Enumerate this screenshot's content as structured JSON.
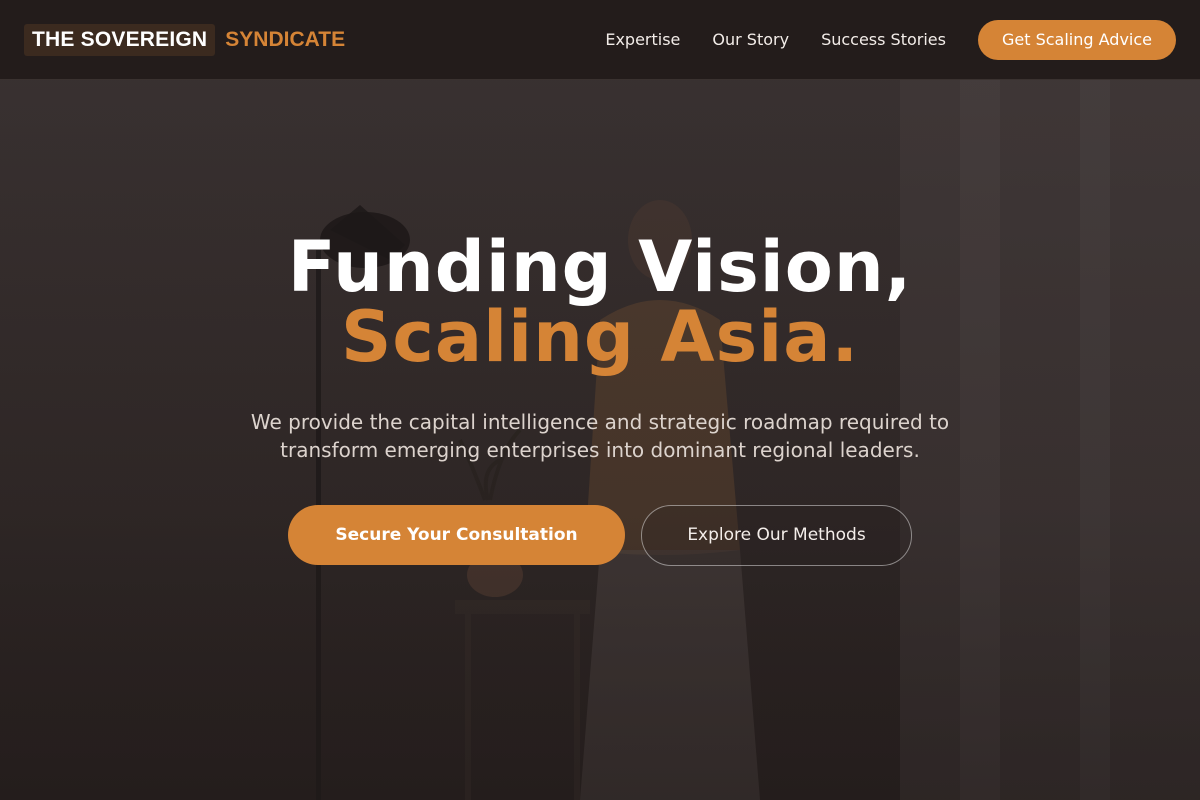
{
  "brand": {
    "name_part1": "THE SOVEREIGN",
    "name_part2": "SYNDICATE"
  },
  "nav": {
    "links": [
      {
        "label": "Expertise"
      },
      {
        "label": "Our Story"
      },
      {
        "label": "Success Stories"
      }
    ],
    "cta_label": "Get Scaling Advice"
  },
  "hero": {
    "title_line1": "Funding Vision,",
    "title_line2": "Scaling Asia.",
    "subtitle": "We provide the capital intelligence and strategic roadmap required to transform emerging enterprises into dominant regional leaders.",
    "primary_button": "Secure Your Consultation",
    "secondary_button": "Explore Our Methods"
  },
  "colors": {
    "accent": "#d58436",
    "header_bg": "#231c1b",
    "hero_bg": "#342c2b",
    "text_light": "#ffffff"
  }
}
